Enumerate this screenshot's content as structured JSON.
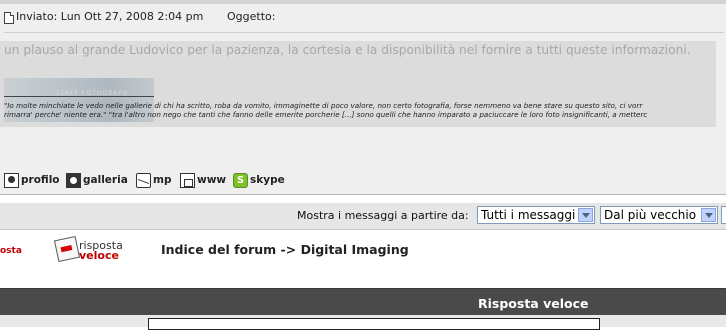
{
  "post": {
    "posted": "Inviato: Lun Ott 27, 2008 2:04 pm",
    "subject_label": "Oggetto:",
    "message": "un plauso al grande Ludovico per la pazienza, la cortesia e la disponibilità nel fornire a tutti queste informazioni.",
    "signature_image_text": "STAFF FOTOGRAFO",
    "signature_quote_1": "\"Io molte minchiate le vedo nelle gallerie di chi ha scritto, roba da vomito, immaginette di poco valore, non certo fotografia, forse nemmeno va bene stare su questo sito, ci vorr",
    "signature_quote_2": "rimarra' perche' niente era.\" \"tra l'altro non nego che tanti che fanno delle emerite porcherie [...] sono quelli che hanno imparato a paciuccare le loro foto insignificanti, a metterc"
  },
  "contacts": {
    "profile": "profilo",
    "gallery": "galleria",
    "pm": "mp",
    "www": "www",
    "skype": "skype",
    "skype_glyph": "S"
  },
  "sort": {
    "label": "Mostra i messaggi a partire da:",
    "messages_value": "Tutti i messaggi",
    "order_value": "Dal più vecchio"
  },
  "nav": {
    "posta_fragment": "osta",
    "quick_reply_line1": "risposta",
    "quick_reply_line2": "veloce",
    "breadcrumb": "Indice del forum -> Digital Imaging"
  },
  "reply": {
    "title": "Risposta veloce"
  },
  "colors": {
    "accent_red": "#c00000",
    "header_dark": "#4a4a4a",
    "skype_green": "#7fbf2a"
  }
}
